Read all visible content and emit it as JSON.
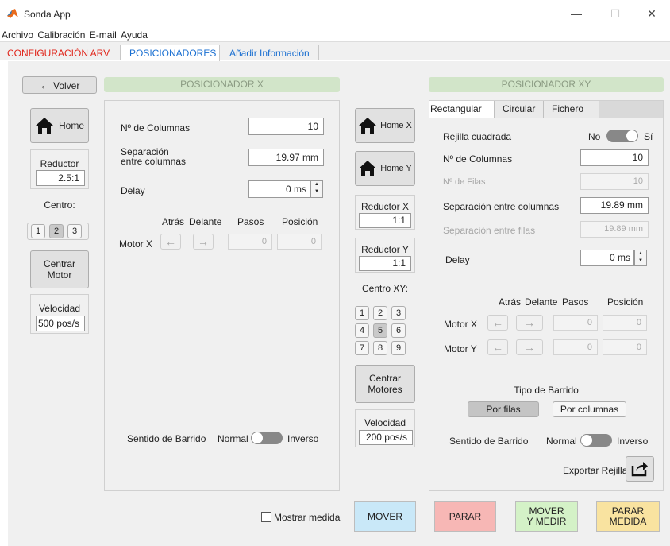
{
  "window": {
    "title": "Sonda App",
    "minimize": "—",
    "maximize": "☐",
    "close": "✕"
  },
  "menu": [
    "Archivo",
    "Calibración",
    "E-mail",
    "Ayuda"
  ],
  "tabs": [
    "CONFIGURACIÓN ARV",
    "POSICIONADORES",
    "Añadir Información"
  ],
  "left": {
    "back_label": "Volver",
    "home_label": "Home",
    "reductor_label": "Reductor",
    "reductor_value": "2.5:1",
    "centro_label": "Centro:",
    "centro_options": [
      "1",
      "2",
      "3"
    ],
    "centrar_label_1": "Centrar",
    "centrar_label_2": "Motor",
    "velocidad_label": "Velocidad",
    "velocidad_value": "500 pos/s"
  },
  "posX": {
    "header": "POSICIONADOR X",
    "columnas_label": "Nº de Columnas",
    "columnas_value": "10",
    "sep_label_1": "Separación",
    "sep_label_2": "entre columnas",
    "sep_value": "19.97 mm",
    "delay_label": "Delay",
    "delay_value": "0 ms",
    "hdr_atras": "Atrás",
    "hdr_delante": "Delante",
    "hdr_pasos": "Pasos",
    "hdr_posicion": "Posición",
    "motor_label": "Motor X",
    "pasos_value": "0",
    "posicion_value": "0",
    "sentido_label": "Sentido de Barrido",
    "normal_label": "Normal",
    "inverso_label": "Inverso"
  },
  "middle": {
    "homex_label": "Home X",
    "homey_label": "Home Y",
    "redx_label": "Reductor X",
    "redx_value": "1:1",
    "redy_label": "Reductor Y",
    "redy_value": "1:1",
    "centroxy_label": "Centro XY:",
    "grid": [
      "1",
      "2",
      "3",
      "4",
      "5",
      "6",
      "7",
      "8",
      "9"
    ],
    "centrar_1": "Centrar",
    "centrar_2": "Motores",
    "vel_label": "Velocidad",
    "vel_value": "200 pos/s"
  },
  "posXY": {
    "header": "POSICIONADOR XY",
    "subtabs": [
      "Rectangular",
      "Circular",
      "Fichero"
    ],
    "rejilla_label": "Rejilla cuadrada",
    "no_label": "No",
    "si_label": "Sí",
    "columnas_label": "Nº de Columnas",
    "columnas_value": "10",
    "filas_label": "Nº de Filas",
    "filas_value": "10",
    "sepcol_label": "Separación entre columnas",
    "sepcol_value": "19.89 mm",
    "sepfil_label": "Separación entre filas",
    "sepfil_value": "19.89 mm",
    "delay_label": "Delay",
    "delay_value": "0 ms",
    "hdr_atras": "Atrás",
    "hdr_delante": "Delante",
    "hdr_pasos": "Pasos",
    "hdr_posicion": "Posición",
    "motorx_label": "Motor X",
    "motory_label": "Motor Y",
    "zero": "0",
    "tipo_label": "Tipo de Barrido",
    "por_filas": "Por filas",
    "por_columnas": "Por columnas",
    "sentido_label": "Sentido de Barrido",
    "normal_label": "Normal",
    "inverso_label": "Inverso",
    "exportar_label": "Exportar Rejilla"
  },
  "bottom": {
    "mostrar_label": "Mostrar medida",
    "mover": "MOVER",
    "parar": "PARAR",
    "mover_medir_1": "MOVER",
    "mover_medir_2": "Y MEDIR",
    "parar_medida_1": "PARAR",
    "parar_medida_2": "MEDIDA"
  },
  "colors": {
    "tab_active": "#1a6fd1",
    "tab_first": "#e0261b",
    "mover": "#c9e8f8",
    "parar": "#f7b7b5",
    "mover_medir": "#d4f2c7",
    "parar_medida": "#f9e3a0",
    "header_green": "#d2e5c9"
  }
}
